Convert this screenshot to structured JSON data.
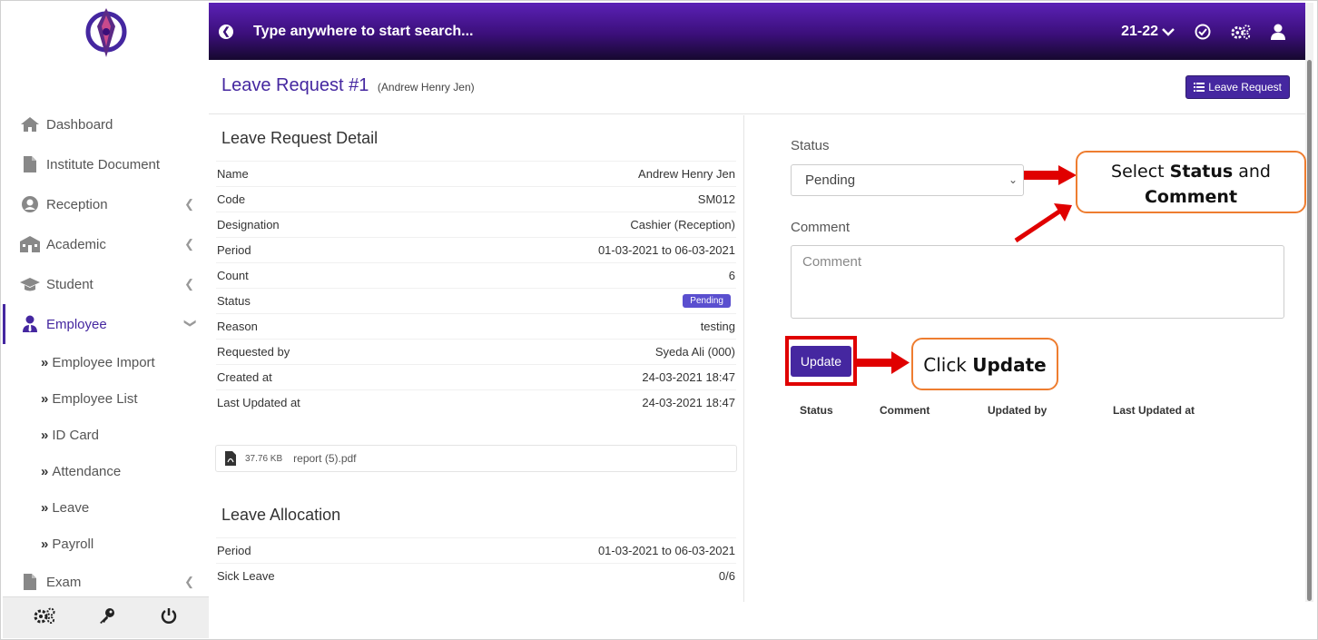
{
  "colors": {
    "brand": "#4527a0",
    "header_gradient_top": "#5b21b6",
    "header_gradient_bottom": "#16082e",
    "badge": "#5a4fcf",
    "annotation_red": "#e00000",
    "annotation_orange": "#ee7d30"
  },
  "header": {
    "back_icon": "arrow-left-circle-icon",
    "search_placeholder": "Type anywhere to start search...",
    "session": "21-22",
    "icons": [
      "chevron-down-icon",
      "check-circle-icon",
      "cogs-icon",
      "user-icon"
    ]
  },
  "sidebar": {
    "items": [
      {
        "label": "Dashboard",
        "icon": "home-icon"
      },
      {
        "label": "Institute Document",
        "icon": "file-icon"
      },
      {
        "label": "Reception",
        "icon": "user-circle-icon"
      },
      {
        "label": "Academic",
        "icon": "school-icon"
      },
      {
        "label": "Student",
        "icon": "graduation-cap-icon"
      },
      {
        "label": "Employee",
        "icon": "user-tie-icon"
      }
    ],
    "sub_items": [
      "Employee Import",
      "Employee List",
      "ID Card",
      "Attendance",
      "Leave",
      "Payroll"
    ],
    "exam": {
      "label": "Exam",
      "icon": "file-icon"
    },
    "footer_icons": [
      "cogs-icon",
      "key-icon",
      "power-icon"
    ]
  },
  "page": {
    "title": "Leave Request #1",
    "subtitle": "(Andrew Henry Jen)",
    "list_button": "Leave Request"
  },
  "detail": {
    "title": "Leave Request Detail",
    "rows": [
      {
        "key": "Name",
        "value": "Andrew Henry Jen"
      },
      {
        "key": "Code",
        "value": "SM012"
      },
      {
        "key": "Designation",
        "value": "Cashier (Reception)"
      },
      {
        "key": "Period",
        "value": "01-03-2021 to 06-03-2021"
      },
      {
        "key": "Count",
        "value": "6"
      },
      {
        "key": "Status",
        "value": "Pending"
      },
      {
        "key": "Reason",
        "value": "testing"
      },
      {
        "key": "Requested by",
        "value": "Syeda Ali (000)"
      },
      {
        "key": "Created at",
        "value": "24-03-2021 18:47"
      },
      {
        "key": "Last Updated at",
        "value": "24-03-2021 18:47"
      }
    ],
    "file": {
      "size": "37.76 KB",
      "name": "report (5).pdf"
    }
  },
  "allocation": {
    "title": "Leave Allocation",
    "rows": [
      {
        "key": "Period",
        "value": "01-03-2021 to 06-03-2021"
      },
      {
        "key": "Sick Leave",
        "value": "0/6"
      }
    ]
  },
  "form": {
    "status_label": "Status",
    "status_value": "Pending",
    "comment_label": "Comment",
    "comment_placeholder": "Comment",
    "update_button": "Update",
    "history_headers": [
      "Status",
      "Comment",
      "Updated by",
      "Last Updated at"
    ]
  },
  "annotations": {
    "select_prefix": "Select ",
    "select_bold1": "Status",
    "select_mid": " and",
    "select_bold2": "Comment",
    "click_prefix": "Click ",
    "click_bold": "Update"
  }
}
